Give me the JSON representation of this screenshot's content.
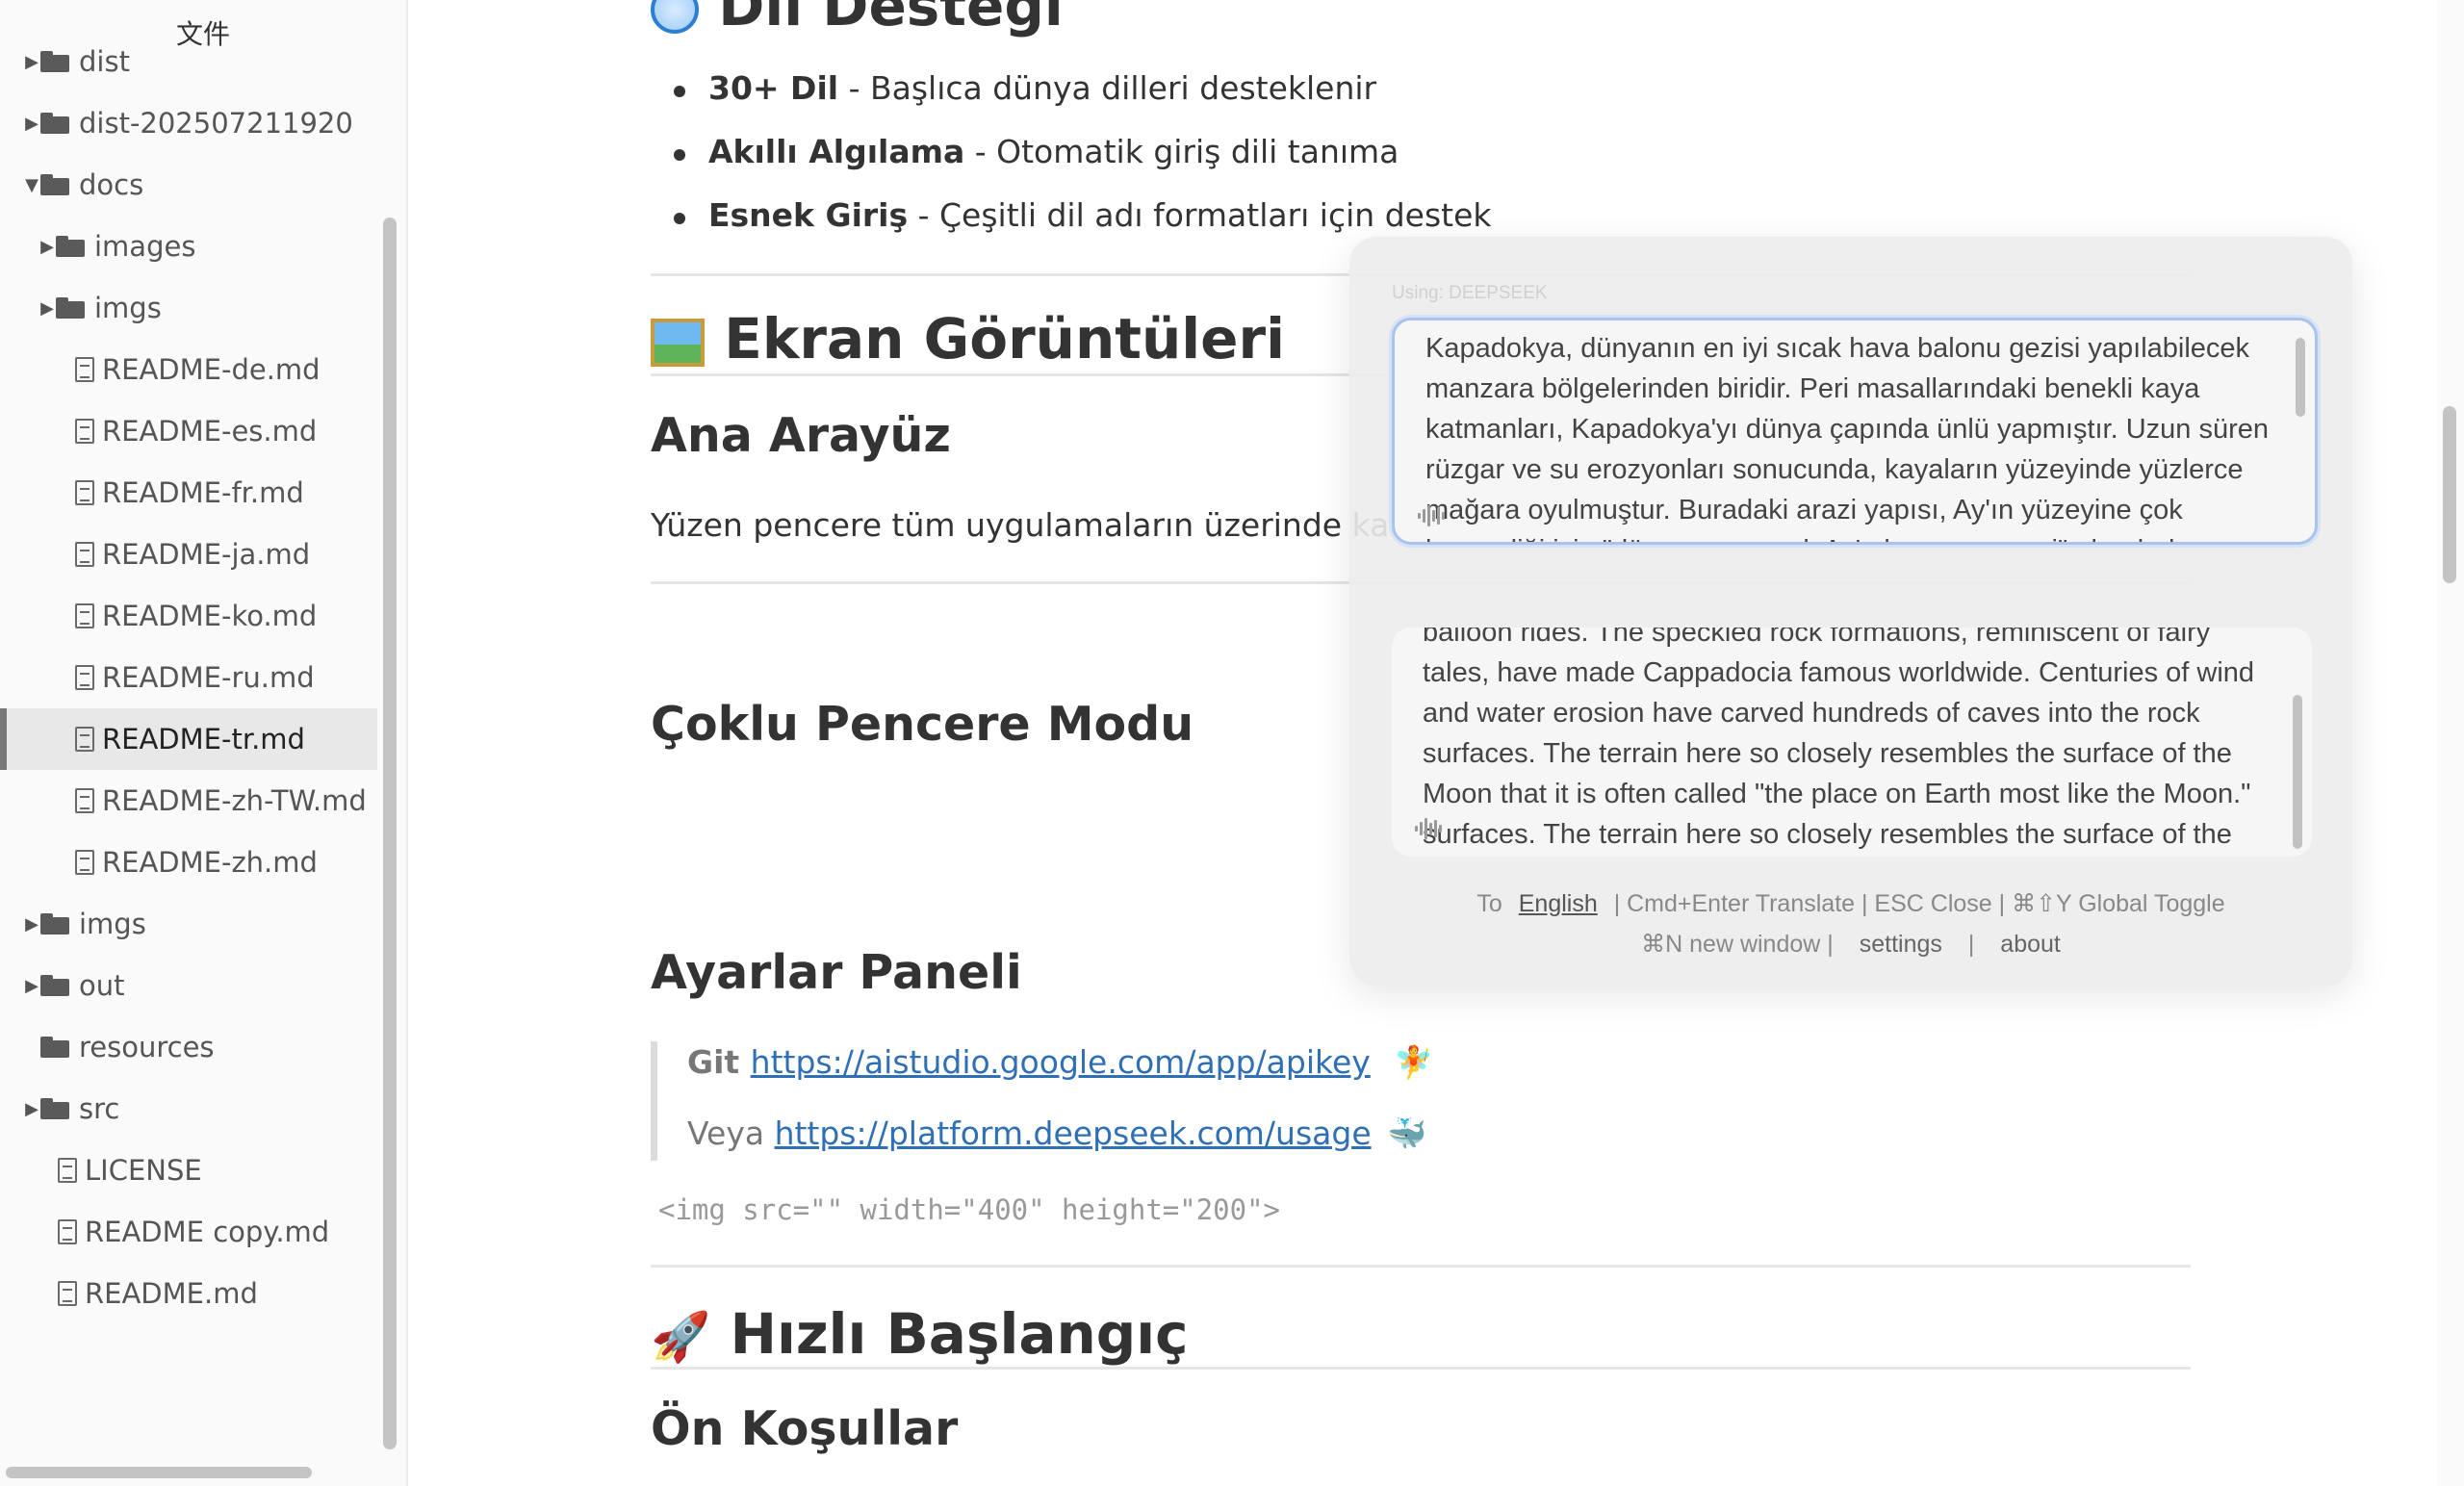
{
  "sidebar": {
    "title": "文件",
    "items": [
      {
        "label": "dist",
        "type": "folder",
        "caret": "▶",
        "active": false
      },
      {
        "label": "dist-202507211920",
        "type": "folder",
        "caret": "▶",
        "active": false
      },
      {
        "label": "docs",
        "type": "folder",
        "caret": "▼",
        "active": false
      },
      {
        "label": "images",
        "type": "folder",
        "caret": "▶",
        "active": false
      },
      {
        "label": "imgs",
        "type": "folder",
        "caret": "▶",
        "active": false
      },
      {
        "label": "README-de.md",
        "type": "file",
        "active": false
      },
      {
        "label": "README-es.md",
        "type": "file",
        "active": false
      },
      {
        "label": "README-fr.md",
        "type": "file",
        "active": false
      },
      {
        "label": "README-ja.md",
        "type": "file",
        "active": false
      },
      {
        "label": "README-ko.md",
        "type": "file",
        "active": false
      },
      {
        "label": "README-ru.md",
        "type": "file",
        "active": false
      },
      {
        "label": "README-tr.md",
        "type": "file",
        "active": true
      },
      {
        "label": "README-zh-TW.md",
        "type": "file",
        "active": false
      },
      {
        "label": "README-zh.md",
        "type": "file",
        "active": false
      },
      {
        "label": "imgs",
        "type": "folder",
        "caret": "▶",
        "active": false
      },
      {
        "label": "out",
        "type": "folder",
        "caret": "▶",
        "active": false
      },
      {
        "label": "resources",
        "type": "folder",
        "caret": "",
        "active": false
      },
      {
        "label": "src",
        "type": "folder",
        "caret": "▶",
        "active": false
      },
      {
        "label": "LICENSE",
        "type": "file",
        "active": false
      },
      {
        "label": "README copy.md",
        "type": "file",
        "active": false
      },
      {
        "label": "README.md",
        "type": "file",
        "active": false
      }
    ]
  },
  "doc": {
    "lang_heading": "Dil Desteği",
    "lang_heading_icon": "🌐",
    "bullets": [
      {
        "bold": "30+ Dil",
        "text": " - Başlıca dünya dilleri desteklenir"
      },
      {
        "bold": "Akıllı Algılama",
        "text": " - Otomatik giriş dili tanıma"
      },
      {
        "bold": "Esnek Giriş",
        "text": " - Çeşitli dil adı formatları için destek"
      }
    ],
    "screens_heading_icon": "🖼️",
    "screens_heading": "Ekran Görüntüleri",
    "main_ui_heading": "Ana Arayüz",
    "main_ui_text": "Yüzen pencere tüm uygulamaların üzerinde kalır",
    "multi_window_heading": "Çoklu Pencere Modu",
    "settings_heading": "Ayarlar Paneli",
    "quote_line1_prefix": "Git ",
    "quote_line1_link": "https://aistudio.google.com/app/apikey",
    "quote_line1_emoji": "🧚",
    "quote_line2_prefix": "Veya ",
    "quote_line2_link": "https://platform.deepseek.com/usage",
    "quote_line2_emoji": "🐳",
    "img_code": "<img src=\"\" width=\"400\" height=\"200\">",
    "quickstart_icon": "🚀",
    "quickstart_heading": "Hızlı Başlangıç",
    "prereq_heading": "Ön Koşullar"
  },
  "translator": {
    "engine_label": "Using: DEEPSEEK",
    "source_lines": [
      "Kapadokya, dünyanın en iyi sıcak hava balonu gezisi yapılabilecek",
      "manzara bölgelerinden biridir. Peri masallarındaki benekli kaya",
      "katmanları, Kapadokya'yı dünya çapında ünlü yapmıştır. Uzun süren",
      "rüzgar ve su erozyonları sonucunda, kayaların yüzeyinde yüzlerce",
      "mağara oyulmuştur. Buradaki arazi yapısı, Ay'ın yüzeyine çok",
      "benzediği için \"dünyanın en çok Ay'a benzeyen yeri\" olarak da"
    ],
    "target_lines": [
      "balloon rides. The speckled rock formations, reminiscent of fairy",
      "tales, have made Cappadocia famous worldwide. Centuries of wind",
      "and water erosion have carved hundreds of caves into the rock",
      "surfaces. The terrain here so closely resembles the surface of the",
      "Moon that it is often called \"the place on Earth most like the Moon.\"",
      "surfaces. The terrain here so closely resembles the surface of the"
    ],
    "to_label": "To",
    "target_language": "English",
    "shortcuts": "| Cmd+Enter Translate | ESC Close | ⌘⇧Y Global Toggle",
    "new_window": "⌘N new window |",
    "settings": "settings",
    "separator": "|",
    "about": "about"
  },
  "colors": {
    "link": "#2f6fb5",
    "accent_border": "#a9c3ec",
    "active_row": "#e8e8e8"
  }
}
